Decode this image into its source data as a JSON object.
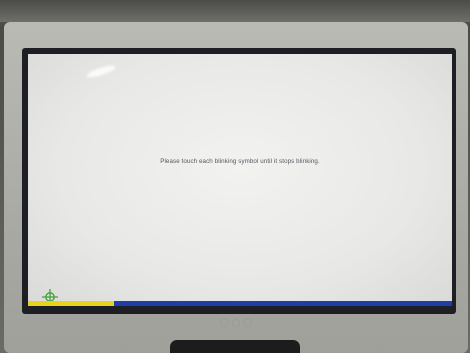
{
  "screen": {
    "instruction": "Please touch each blinking symbol until it stops blinking."
  },
  "calibration": {
    "icon": "crosshair-target-icon",
    "color": "#3aa035"
  },
  "colors": {
    "screen_bg": "#ececea",
    "status_strip": "#1f3fa8",
    "status_strip_accent": "#e8d21a",
    "bezel": "#b2b3ad"
  }
}
